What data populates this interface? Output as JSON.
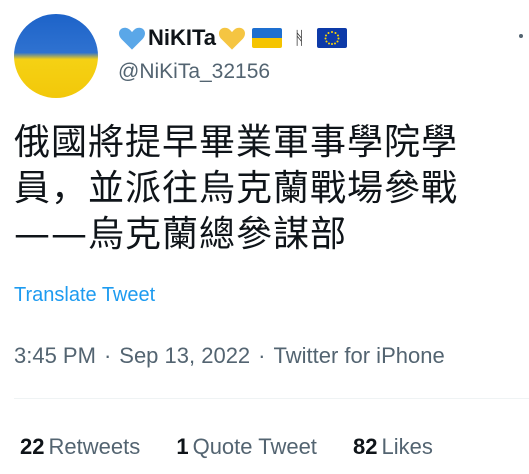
{
  "user": {
    "display_name": "NiKITa",
    "handle": "@NiKiTa_32156",
    "avatar_icon": "ukraine-flag-avatar",
    "emoji_left": "blue-heart-icon",
    "emoji_right": "yellow-heart-icon",
    "flags": [
      "ukraine-flag-icon",
      "rune-icon",
      "eu-flag-icon"
    ],
    "rune_glyph": "ᚻ"
  },
  "tweet": {
    "text": "俄國將提早畢業軍事學院學員，並派往烏克蘭戰場參戰——烏克蘭總參謀部",
    "translate_label": "Translate Tweet",
    "time": "3:45 PM",
    "date": "Sep 13, 2022",
    "source": "Twitter for iPhone",
    "separator": "·"
  },
  "stats": {
    "retweets_count": "22",
    "retweets_label": "Retweets",
    "quotes_count": "1",
    "quotes_label": "Quote Tweet",
    "likes_count": "82",
    "likes_label": "Likes"
  },
  "colors": {
    "link": "#1d9bf0",
    "secondary_text": "#536471",
    "primary_text": "#0f1419",
    "blue_heart": "#5aa7e8",
    "yellow_heart": "#f5c542"
  }
}
